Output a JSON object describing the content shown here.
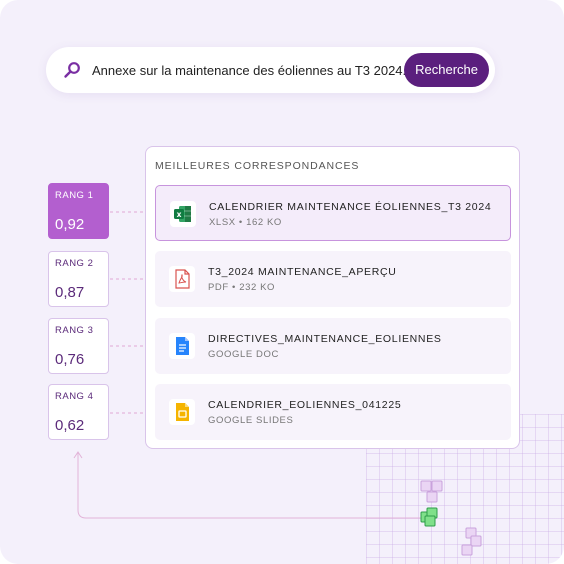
{
  "search": {
    "query": "Annexe sur la maintenance des éoliennes au T3 2024.",
    "button_label": "Recherche"
  },
  "results": {
    "title": "MEILLEURES CORRESPONDANCES",
    "items": [
      {
        "name": "CALENDRIER MAINTENANCE ÉOLIENNES_T3 2024",
        "meta": "XLSX • 162 KO",
        "icon": "excel-icon",
        "selected": true
      },
      {
        "name": "T3_2024 MAINTENANCE_APERÇU",
        "meta": "PDF • 232 KO",
        "icon": "pdf-icon",
        "selected": false
      },
      {
        "name": "DIRECTIVES_MAINTENANCE_EOLIENNES",
        "meta": "GOOGLE DOC",
        "icon": "google-docs-icon",
        "selected": false
      },
      {
        "name": "CALENDRIER_EOLIENNES_041225",
        "meta": "GOOGLE SLIDES",
        "icon": "google-slides-icon",
        "selected": false
      }
    ]
  },
  "ranks": [
    {
      "label": "RANG 1",
      "score": "0,92"
    },
    {
      "label": "RANG 2",
      "score": "0,87"
    },
    {
      "label": "RANG 3",
      "score": "0,76"
    },
    {
      "label": "RANG 4",
      "score": "0,62"
    }
  ],
  "colors": {
    "accent": "#5b1f7e",
    "rank_highlight": "#b35fcf",
    "background": "#f4f0fb",
    "card_border": "#d9c4ea"
  }
}
